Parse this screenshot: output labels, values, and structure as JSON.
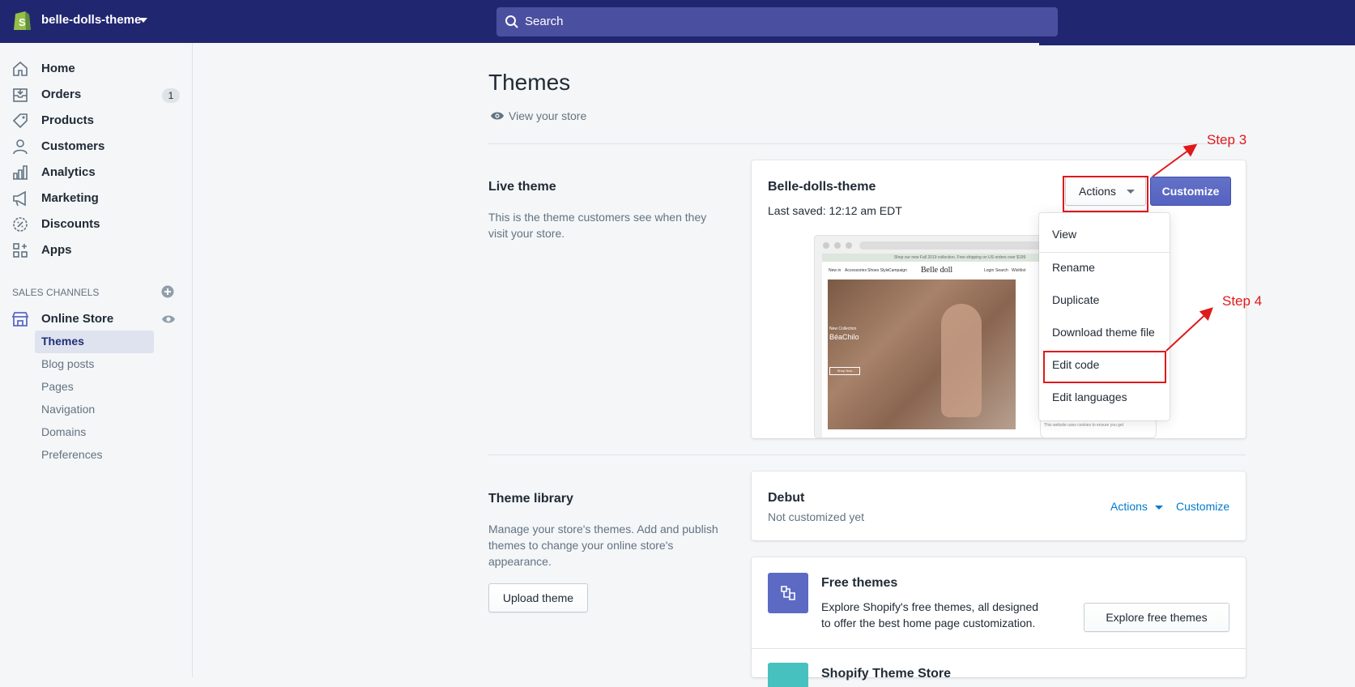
{
  "topbar": {
    "store_name": "belle-dolls-theme",
    "search_placeholder": "Search"
  },
  "sidebar": {
    "items": [
      {
        "label": "Home",
        "icon": "home-icon"
      },
      {
        "label": "Orders",
        "icon": "orders-icon",
        "badge": "1"
      },
      {
        "label": "Products",
        "icon": "tag-icon"
      },
      {
        "label": "Customers",
        "icon": "person-icon"
      },
      {
        "label": "Analytics",
        "icon": "bar-chart-icon"
      },
      {
        "label": "Marketing",
        "icon": "megaphone-icon"
      },
      {
        "label": "Discounts",
        "icon": "discount-icon"
      },
      {
        "label": "Apps",
        "icon": "apps-icon"
      }
    ],
    "sales_channels_label": "SALES CHANNELS",
    "online_store_label": "Online Store",
    "sub_items": [
      "Themes",
      "Blog posts",
      "Pages",
      "Navigation",
      "Domains",
      "Preferences"
    ]
  },
  "main": {
    "title": "Themes",
    "view_store": "View your store",
    "live_theme": {
      "heading": "Live theme",
      "description": "This is the theme customers see when they visit your store.",
      "name": "Belle-dolls-theme",
      "last_saved": "Last saved: 12:12 am EDT",
      "actions_label": "Actions",
      "customize_label": "Customize"
    },
    "dropdown": [
      "View",
      "Rename",
      "Duplicate",
      "Download theme file",
      "Edit code",
      "Edit languages"
    ],
    "preview": {
      "banner": "Shop our new Fall 2019 collection. Free shipping on US orders over $199",
      "nav_left": [
        "New in",
        "Accessories",
        "Shoes Style",
        "Campaign"
      ],
      "logo": "Belle doll",
      "nav_right": [
        "Login",
        "Search",
        "Wishlist"
      ],
      "hero_small": "New Collection",
      "hero_title": "BéaChilo",
      "hero_button": "Shop Now",
      "cookie_text": "This website uses cookies to ensure you get"
    },
    "library": {
      "heading": "Theme library",
      "description": "Manage your store's themes. Add and publish themes to change your online store's appearance.",
      "upload_label": "Upload theme",
      "debut_name": "Debut",
      "debut_status": "Not customized yet",
      "actions_label": "Actions",
      "customize_label": "Customize",
      "free_title": "Free themes",
      "free_desc": "Explore Shopify's free themes, all designed to offer the best home page customization.",
      "explore_label": "Explore free themes",
      "store_title": "Shopify Theme Store"
    }
  },
  "annotations": {
    "step3": "Step 3",
    "step4": "Step 4",
    "color": "#e0191b"
  },
  "colors": {
    "topbar": "#212671",
    "primary": "#5c6ac4",
    "link": "#007ace"
  }
}
